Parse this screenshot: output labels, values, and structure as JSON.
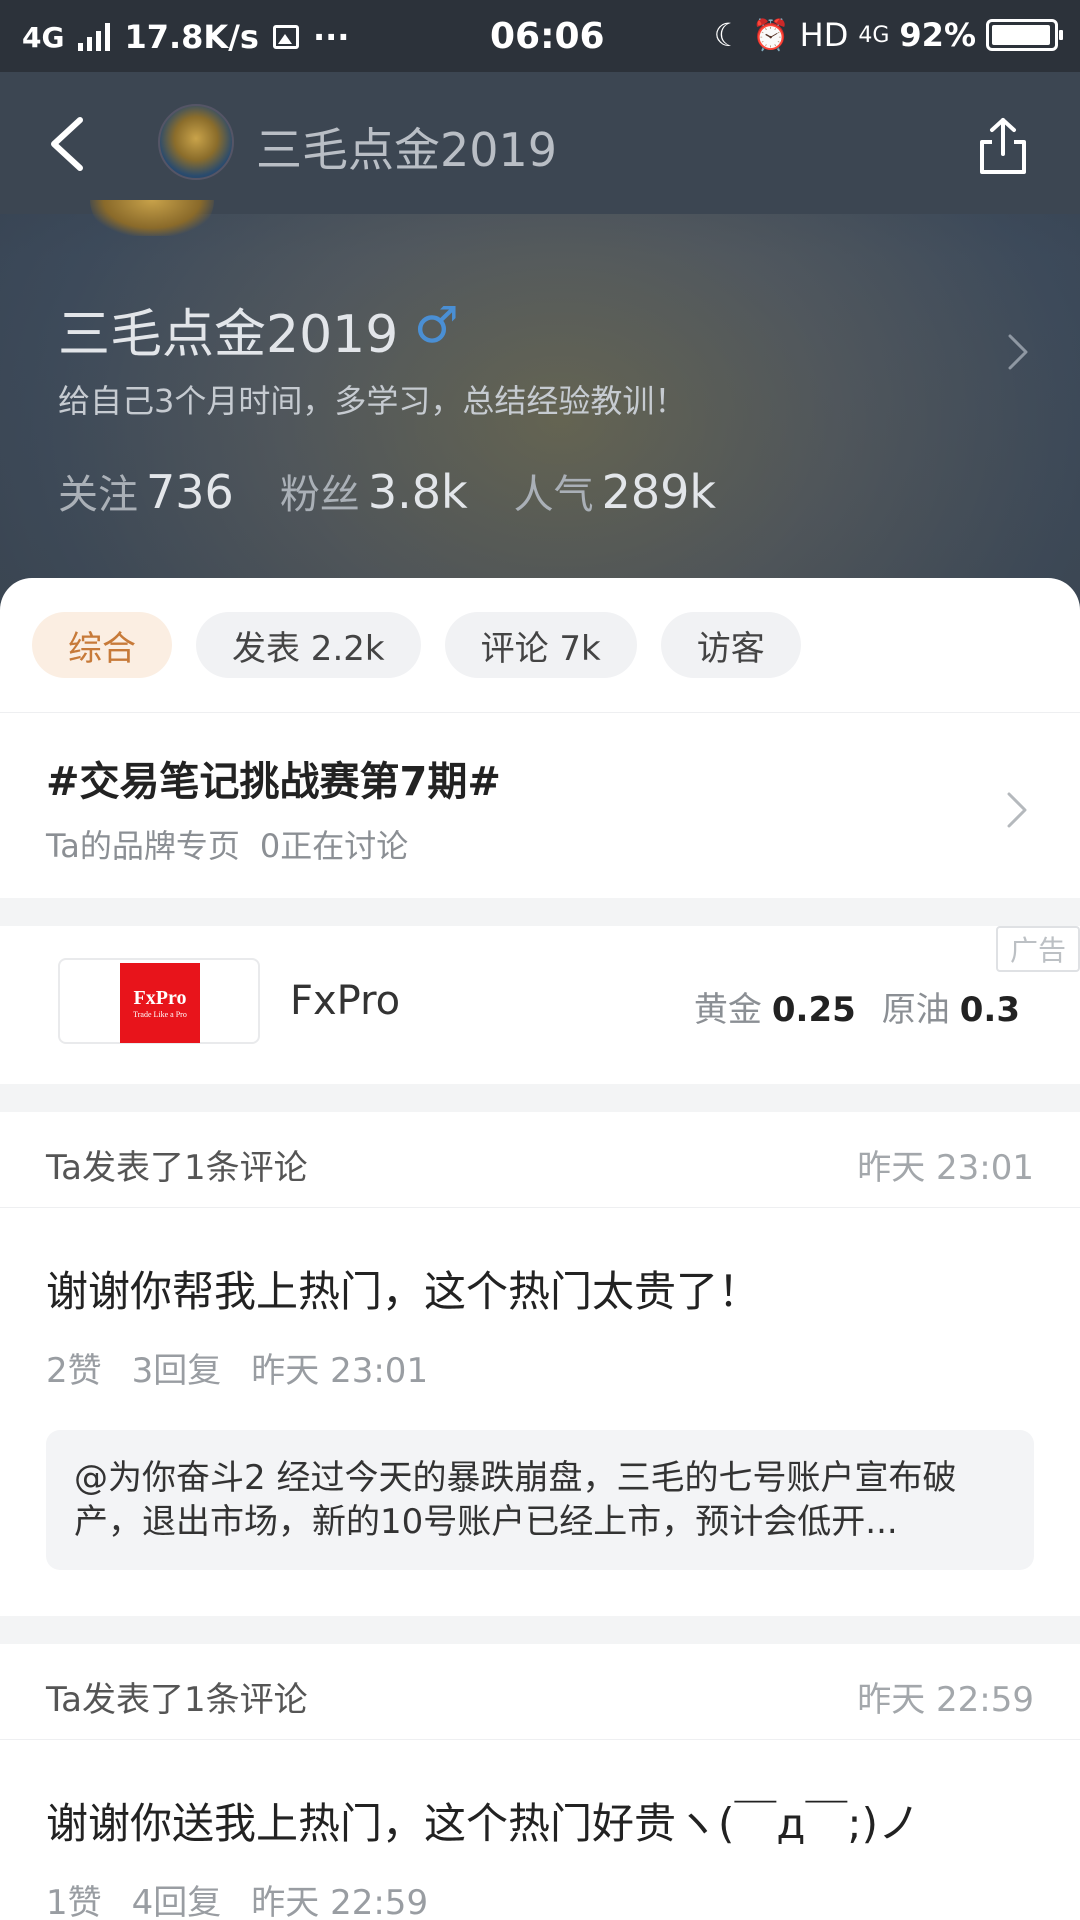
{
  "status_bar": {
    "network": "4G",
    "speed": "17.8K/s",
    "more": "···",
    "time": "06:06",
    "hd": "HD",
    "net2": "4G",
    "battery": "92%"
  },
  "nav": {
    "title": "三毛点金2019"
  },
  "profile": {
    "name": "三毛点金2019",
    "gender_icon": "♂",
    "bio": "给自己3个月时间，多学习，总结经验教训！",
    "stats": [
      {
        "label": "关注",
        "value": "736"
      },
      {
        "label": "粉丝",
        "value": "3.8k"
      },
      {
        "label": "人气",
        "value": "289k"
      }
    ]
  },
  "tabs": [
    {
      "label": "综合",
      "active": true
    },
    {
      "label": "发表 2.2k",
      "active": false
    },
    {
      "label": "评论 7k",
      "active": false
    },
    {
      "label": "访客",
      "active": false
    }
  ],
  "topic": {
    "title": "#交易笔记挑战赛第7期#",
    "brand_page": "Ta的品牌专页",
    "discussing": "0正在讨论"
  },
  "ad": {
    "tag": "广告",
    "logo_line1": "FxPro",
    "logo_line2": "Trade Like a Pro",
    "name": "FxPro",
    "quotes": [
      {
        "label": "黄金",
        "value": "0.25"
      },
      {
        "label": "原油",
        "value": "0.3"
      }
    ]
  },
  "posts": [
    {
      "header": "Ta发表了1条评论",
      "time": "昨天 23:01",
      "text": "谢谢你帮我上热门，这个热门太贵了！",
      "likes": "2赞",
      "replies": "3回复",
      "meta_time": "昨天 23:01",
      "quote": "@为你奋斗2 经过今天的暴跌崩盘，三毛的七号账户宣布破产，退出市场，新的10号账户已经上市，预计会低开..."
    },
    {
      "header": "Ta发表了1条评论",
      "time": "昨天 22:59",
      "text": "谢谢你送我上热门，这个热门好贵ヽ(￣д￣;)ノ",
      "likes": "1赞",
      "replies": "4回复",
      "meta_time": "昨天 22:59"
    }
  ],
  "colors": {
    "accent_tab_bg": "#fbeee2",
    "accent_tab_text": "#c77a39",
    "gender_blue": "#4a8fd4",
    "fxpro_red": "#e8141b"
  }
}
